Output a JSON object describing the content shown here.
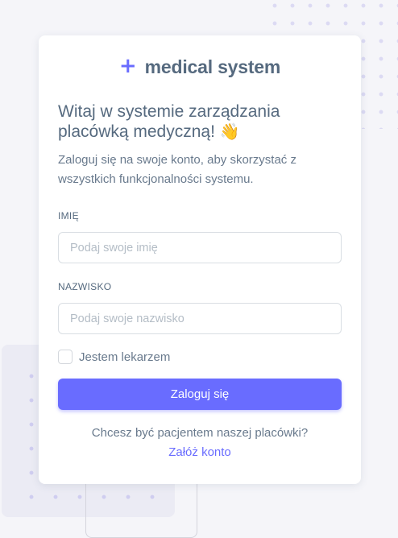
{
  "brand": {
    "icon": "plus-icon",
    "icon_glyph": "+",
    "name": "medical system",
    "accent_color": "#696cff"
  },
  "welcome": {
    "heading": "Witaj w systemie zarządzania placówką medyczną!",
    "emoji": "👋",
    "subtitle": "Zaloguj się na swoje konto, aby skorzystać z wszystkich funkcjonalności systemu."
  },
  "form": {
    "first_name": {
      "label": "IMIĘ",
      "placeholder": "Podaj swoje imię",
      "value": ""
    },
    "last_name": {
      "label": "NAZWISKO",
      "placeholder": "Podaj swoje nazwisko",
      "value": ""
    },
    "doctor_checkbox": {
      "label": "Jestem lekarzem",
      "checked": false
    },
    "submit_label": "Zaloguj się"
  },
  "footer": {
    "question": "Chcesz być pacjentem naszej placówki?",
    "register_link": "Załóż konto"
  }
}
